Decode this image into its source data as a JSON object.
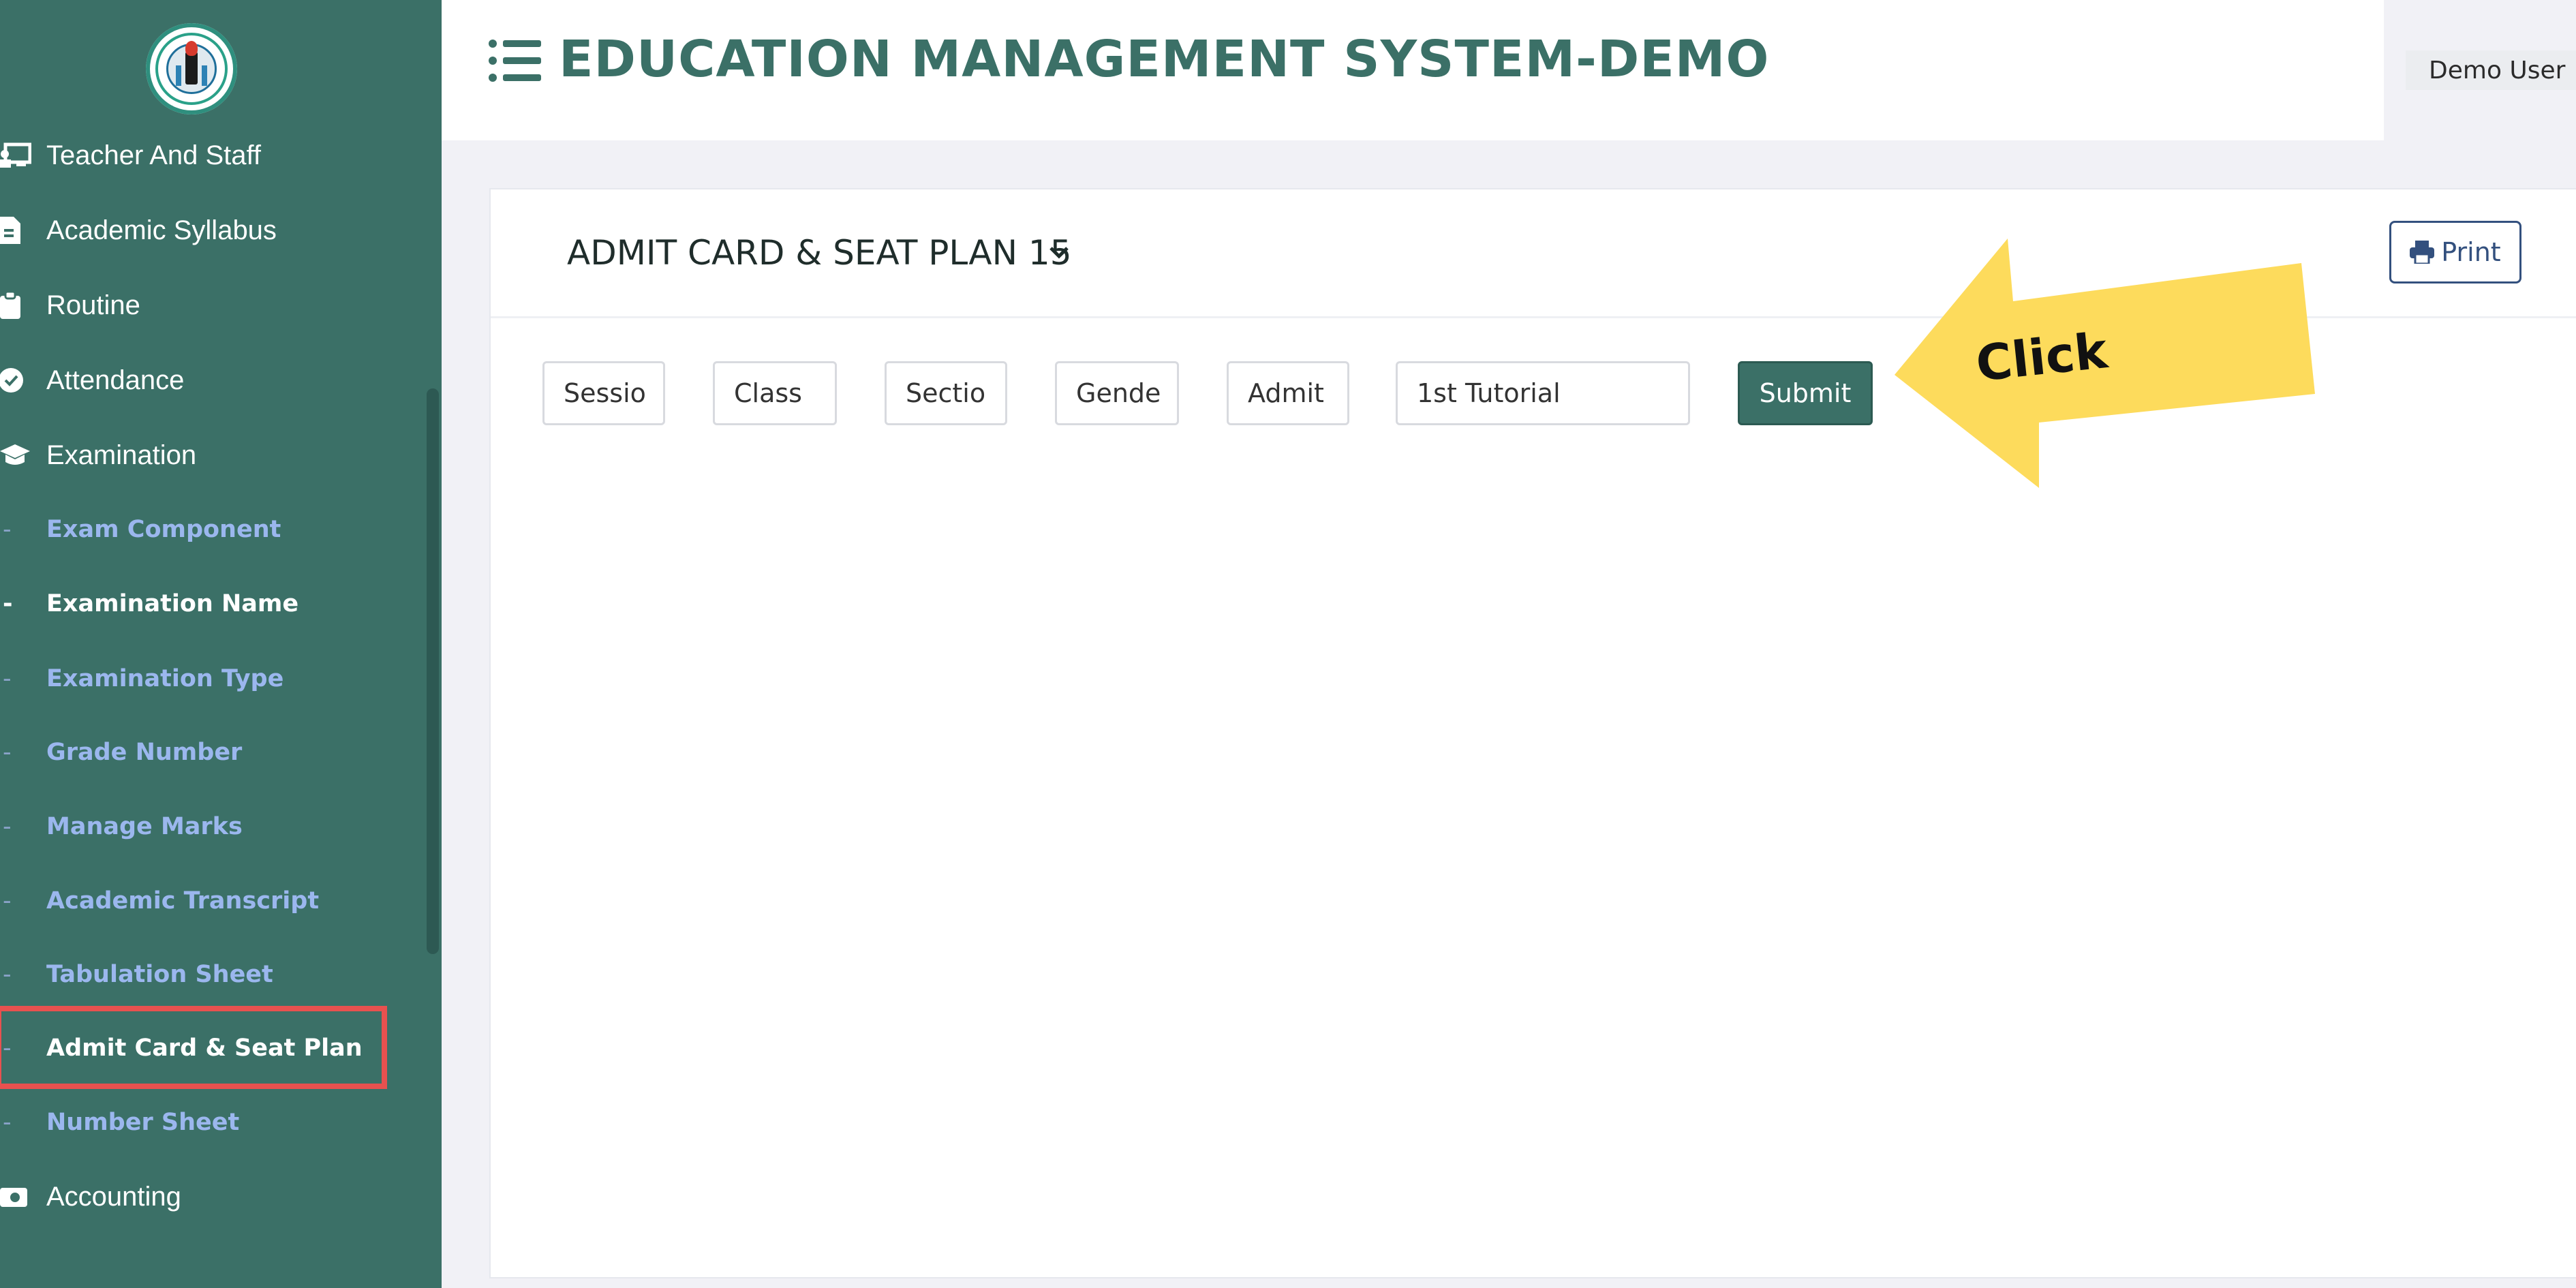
{
  "header": {
    "title": "EDUCATION MANAGEMENT SYSTEM-DEMO",
    "user_name": "Demo User"
  },
  "sidebar": {
    "items": [
      {
        "label": "Teacher And Staff",
        "icon": "teacher-icon"
      },
      {
        "label": "Academic Syllabus",
        "icon": "document-icon"
      },
      {
        "label": "Routine",
        "icon": "clipboard-icon"
      },
      {
        "label": "Attendance",
        "icon": "check-circle-icon"
      },
      {
        "label": "Examination",
        "icon": "graduation-cap-icon"
      }
    ],
    "exam_subitems": [
      "Exam Component",
      "Examination Name",
      "Examination Type",
      "Grade Number",
      "Manage Marks",
      "Academic Transcript",
      "Tabulation Sheet",
      "Admit Card & Seat Plan",
      "Number Sheet"
    ],
    "bottom_item": {
      "label": "Accounting",
      "icon": "money-icon"
    },
    "dash": "-"
  },
  "card": {
    "title": "ADMIT CARD & SEAT PLAN 15",
    "print_label": "Print",
    "filters": [
      {
        "name": "session",
        "text": "Sessio"
      },
      {
        "name": "class",
        "text": "Class"
      },
      {
        "name": "section",
        "text": "Sectio"
      },
      {
        "name": "gender",
        "text": "Gende"
      },
      {
        "name": "admit",
        "text": "Admit"
      },
      {
        "name": "exam",
        "text": "1st Tutorial"
      }
    ],
    "submit_label": "Submit"
  },
  "annotation": {
    "arrow_label": "Click",
    "arrow_color": "#fddb5c"
  },
  "colors": {
    "sidebar": "#3b7067",
    "accent": "#3b7067",
    "highlight": "#e8514f",
    "link": "#33507e"
  }
}
